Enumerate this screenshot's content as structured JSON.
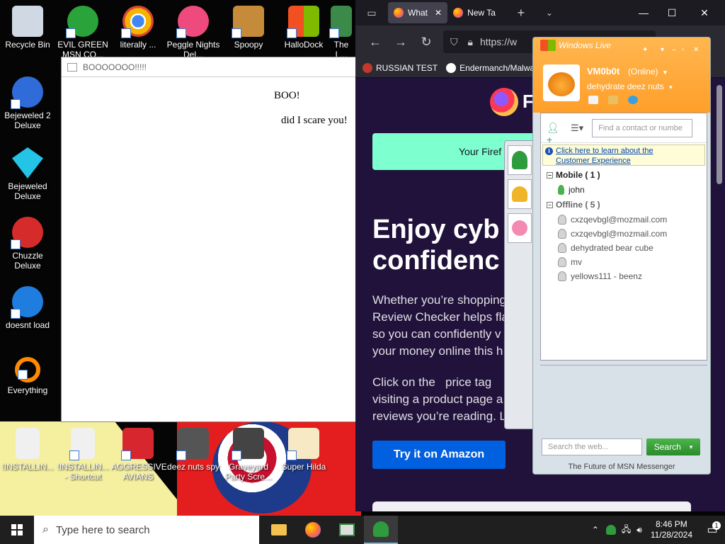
{
  "desktop": {
    "icons": [
      {
        "label": "Recycle Bin",
        "color": "#cfd8e3"
      },
      {
        "label": "EVIL GREEN MSN CO...",
        "color": "#29a33a"
      },
      {
        "label": "literally ...",
        "color": "#f4b400"
      },
      {
        "label": "Peggle Nights Del...",
        "color": "#ef4a7d"
      },
      {
        "label": "Spoopy",
        "color": "#c58b3b"
      },
      {
        "label": "HalloDock",
        "color": "#00a4ef"
      },
      {
        "label": "The L...",
        "color": "#3b8a4a"
      },
      {
        "label": "Bejeweled 2 Deluxe",
        "color": "#2f6bd9"
      },
      {
        "label": "Bejeweled Deluxe",
        "color": "#23c4e6"
      },
      {
        "label": "Chuzzle Deluxe",
        "color": "#d62b2b"
      },
      {
        "label": "doesnt load",
        "color": "#1f7de0"
      },
      {
        "label": "Everything",
        "color": "#ff8a00"
      },
      {
        "label": "!INSTALLIN...",
        "color": "#f0f0f0"
      },
      {
        "label": "!INSTALLIN... - Shortcut",
        "color": "#f0f0f0"
      },
      {
        "label": "AGGRESSIVE AVIANS",
        "color": "#d7262e"
      },
      {
        "label": "deez nuts spy",
        "color": "#555555"
      },
      {
        "label": "Graveyard Party Scre...",
        "color": "#444444"
      },
      {
        "label": "Super Hilda",
        "color": "#f6e9c4"
      }
    ]
  },
  "boo_window": {
    "title": "BOOOOOOO!!!!!",
    "line1": "BOO!",
    "line2": "did I scare you!"
  },
  "firefox": {
    "tabs": [
      {
        "label": "What"
      },
      {
        "label": "New Ta"
      }
    ],
    "url": "https://w",
    "bookmarks": [
      {
        "label": "RUSSIAN TEST"
      },
      {
        "label": "Endermanch/Malwar"
      }
    ],
    "logo_letter": "F",
    "banner": "Your Firef",
    "headline_1": "Enjoy cyb",
    "headline_2": "confidenc",
    "para_1": "Whether you’re shopping\nReview Checker helps fla\nso you can confidently v\nyour money online this h",
    "para_2": "Click on the   price tag\nvisiting a product page a\nreviews you’re reading. L",
    "cta": "Try it on Amazon"
  },
  "msn": {
    "title": "Windows Live",
    "user_name": "VM0b0t",
    "user_status": "(Online)",
    "personal_message": "dehydrate deez nuts",
    "find_placeholder": "Find a contact or numbe",
    "info_line1": "Click here to learn about the",
    "info_line2": "Customer Experience",
    "mobile_group": "Mobile ( 1 )",
    "mobile_contacts": [
      "john"
    ],
    "offline_group": "Offline ( 5 )",
    "offline_contacts": [
      "cxzqevbgl@mozmail.com",
      "cxzqevbgl@mozmail.com",
      "dehydrated bear cube",
      "mv",
      "yellows111 - beenz"
    ],
    "web_search_placeholder": "Search the web...",
    "search_button": "Search",
    "footer": "The Future of MSN Messenger"
  },
  "taskbar": {
    "search_placeholder": "Type here to search",
    "time": "8:46 PM",
    "date": "11/28/2024",
    "notifications": "1"
  }
}
